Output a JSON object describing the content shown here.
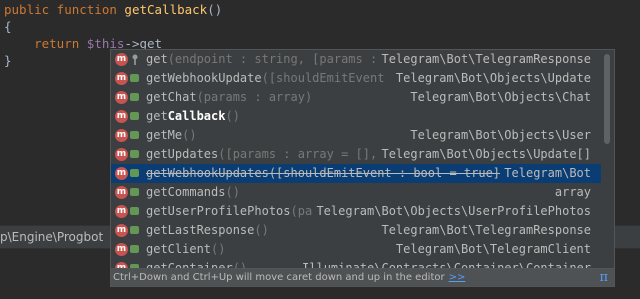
{
  "editor": {
    "line1": {
      "kw": "public function ",
      "fn": "getCallback",
      "rest": "()"
    },
    "line2": "{",
    "line3": {
      "indent": "    ",
      "kw": "return ",
      "var": "$this",
      "arrow": "->",
      "typed": "get"
    },
    "line4": "}"
  },
  "path_bar": {
    "text": "p\\Engine\\Progbot"
  },
  "completion": {
    "items": [
      {
        "name_pre": "get",
        "name_bold": "",
        "params": "(endpoint : string, [params : ",
        "type": "Telegram\\Bot\\TelegramResponse",
        "access": "pin",
        "deprecated": false,
        "selected": false
      },
      {
        "name_pre": "getWebhookUpdate",
        "name_bold": "",
        "params": "([shouldEmitEvent : ",
        "type": "Telegram\\Bot\\Objects\\Update",
        "access": "public",
        "deprecated": false,
        "selected": false
      },
      {
        "name_pre": "getChat",
        "name_bold": "",
        "params": "(params : array)",
        "type": "Telegram\\Bot\\Objects\\Chat",
        "access": "public",
        "deprecated": false,
        "selected": false
      },
      {
        "name_pre": "get",
        "name_bold": "Callback",
        "params": "()",
        "type": "",
        "access": "public",
        "deprecated": false,
        "selected": false
      },
      {
        "name_pre": "getMe",
        "name_bold": "",
        "params": "()",
        "type": "Telegram\\Bot\\Objects\\User",
        "access": "public",
        "deprecated": false,
        "selected": false
      },
      {
        "name_pre": "getUpdates",
        "name_bold": "",
        "params": "([params : array = [], ",
        "type": "Telegram\\Bot\\Objects\\Update[]",
        "access": "public",
        "deprecated": false,
        "selected": false
      },
      {
        "name_pre": "getWebhookUpdates",
        "name_bold": "",
        "params": "([shouldEmitEvent : bool = true])",
        "type": "Telegram\\Bot",
        "access": "public",
        "deprecated": true,
        "selected": true
      },
      {
        "name_pre": "getCommands",
        "name_bold": "",
        "params": "()",
        "type": "array",
        "access": "public",
        "deprecated": false,
        "selected": false
      },
      {
        "name_pre": "getUserProfilePhotos",
        "name_bold": "",
        "params": "(par",
        "type": "Telegram\\Bot\\Objects\\UserProfilePhotos",
        "access": "public",
        "deprecated": false,
        "selected": false
      },
      {
        "name_pre": "getLastResponse",
        "name_bold": "",
        "params": "()",
        "type": "Telegram\\Bot\\TelegramResponse",
        "access": "public",
        "deprecated": false,
        "selected": false
      },
      {
        "name_pre": "getClient",
        "name_bold": "",
        "params": "()",
        "type": "Telegram\\Bot\\TelegramClient",
        "access": "public",
        "deprecated": false,
        "selected": false
      },
      {
        "name_pre": "getContainer",
        "name_bold": "",
        "params": "()",
        "type": "Illuminate\\Contracts\\Container\\Container",
        "access": "public",
        "deprecated": false,
        "selected": false
      }
    ],
    "footer": {
      "hint": "Ctrl+Down and Ctrl+Up will move caret down and up in the editor",
      "link": ">>",
      "pi": "π"
    }
  },
  "colors": {
    "background": "#2b2b2b",
    "popup": "#3c3f41",
    "selection": "#0a3d73",
    "method_icon": "#c75450",
    "link": "#589df6"
  }
}
